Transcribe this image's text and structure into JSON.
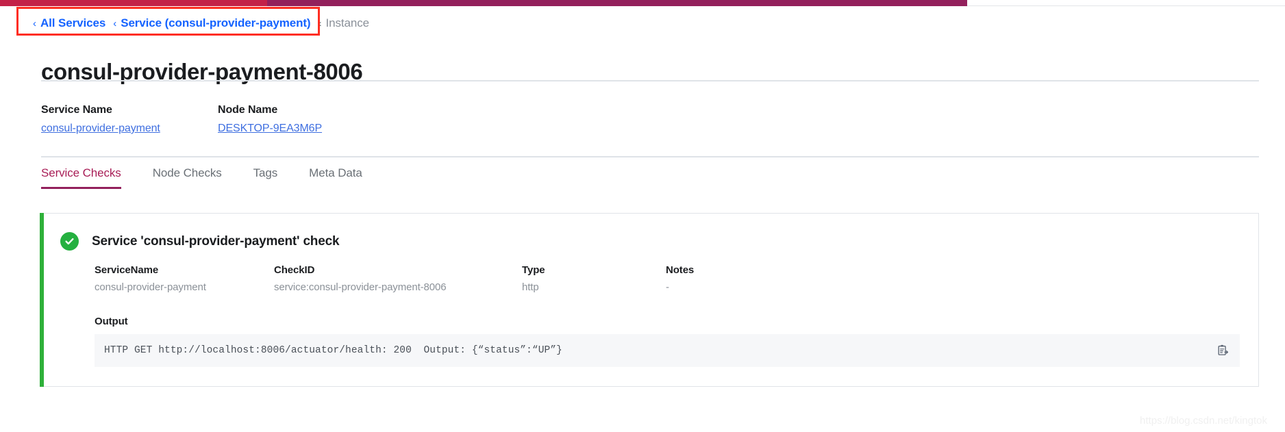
{
  "theme": {
    "brand_magenta": "#93205c",
    "brand_crimson": "#c32148",
    "link_blue": "#1563ff",
    "success_green": "#25b040",
    "muted_gray": "#8b9198",
    "annotation_red": "#ff2d21"
  },
  "breadcrumb": {
    "chevron_glyph": "‹",
    "items": [
      {
        "label": "All Services",
        "type": "link"
      },
      {
        "label": "Service (consul-provider-payment)",
        "type": "link"
      },
      {
        "label": "Instance",
        "type": "current"
      }
    ]
  },
  "page": {
    "title": "consul-provider-payment-8006"
  },
  "meta": [
    {
      "label": "Service Name",
      "value": "consul-provider-payment"
    },
    {
      "label": "Node Name",
      "value": "DESKTOP-9EA3M6P"
    }
  ],
  "tabs": [
    {
      "label": "Service Checks",
      "active": true
    },
    {
      "label": "Node Checks",
      "active": false
    },
    {
      "label": "Tags",
      "active": false
    },
    {
      "label": "Meta Data",
      "active": false
    }
  ],
  "check": {
    "status": "passing",
    "title": "Service 'consul-provider-payment' check",
    "fields": [
      {
        "label": "ServiceName",
        "value": "consul-provider-payment"
      },
      {
        "label": "CheckID",
        "value": "service:consul-provider-payment-8006"
      },
      {
        "label": "Type",
        "value": "http"
      },
      {
        "label": "Notes",
        "value": "-"
      }
    ],
    "output_label": "Output",
    "output_text": "HTTP GET http://localhost:8006/actuator/health: 200  Output: {“status”:“UP”}",
    "copy_icon": "clipboard-copy-icon"
  },
  "watermark": {
    "text": "https://blog.csdn.net/kingtok"
  }
}
